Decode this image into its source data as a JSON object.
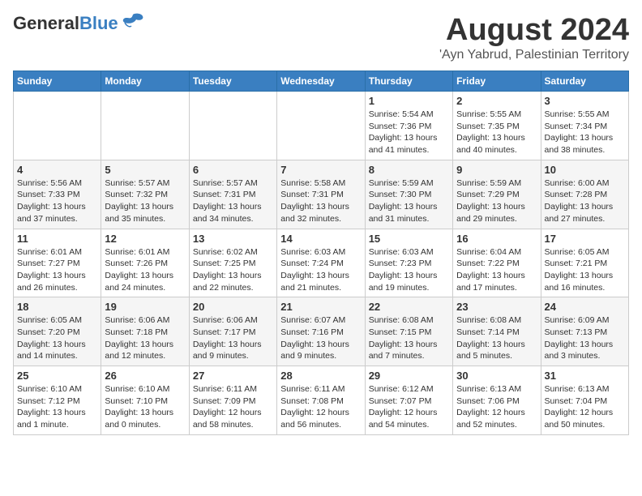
{
  "header": {
    "logo_general": "General",
    "logo_blue": "Blue",
    "month_year": "August 2024",
    "location": "'Ayn Yabrud, Palestinian Territory"
  },
  "weekdays": [
    "Sunday",
    "Monday",
    "Tuesday",
    "Wednesday",
    "Thursday",
    "Friday",
    "Saturday"
  ],
  "weeks": [
    [
      {
        "day": "",
        "info": ""
      },
      {
        "day": "",
        "info": ""
      },
      {
        "day": "",
        "info": ""
      },
      {
        "day": "",
        "info": ""
      },
      {
        "day": "1",
        "info": "Sunrise: 5:54 AM\nSunset: 7:36 PM\nDaylight: 13 hours and 41 minutes."
      },
      {
        "day": "2",
        "info": "Sunrise: 5:55 AM\nSunset: 7:35 PM\nDaylight: 13 hours and 40 minutes."
      },
      {
        "day": "3",
        "info": "Sunrise: 5:55 AM\nSunset: 7:34 PM\nDaylight: 13 hours and 38 minutes."
      }
    ],
    [
      {
        "day": "4",
        "info": "Sunrise: 5:56 AM\nSunset: 7:33 PM\nDaylight: 13 hours and 37 minutes."
      },
      {
        "day": "5",
        "info": "Sunrise: 5:57 AM\nSunset: 7:32 PM\nDaylight: 13 hours and 35 minutes."
      },
      {
        "day": "6",
        "info": "Sunrise: 5:57 AM\nSunset: 7:31 PM\nDaylight: 13 hours and 34 minutes."
      },
      {
        "day": "7",
        "info": "Sunrise: 5:58 AM\nSunset: 7:31 PM\nDaylight: 13 hours and 32 minutes."
      },
      {
        "day": "8",
        "info": "Sunrise: 5:59 AM\nSunset: 7:30 PM\nDaylight: 13 hours and 31 minutes."
      },
      {
        "day": "9",
        "info": "Sunrise: 5:59 AM\nSunset: 7:29 PM\nDaylight: 13 hours and 29 minutes."
      },
      {
        "day": "10",
        "info": "Sunrise: 6:00 AM\nSunset: 7:28 PM\nDaylight: 13 hours and 27 minutes."
      }
    ],
    [
      {
        "day": "11",
        "info": "Sunrise: 6:01 AM\nSunset: 7:27 PM\nDaylight: 13 hours and 26 minutes."
      },
      {
        "day": "12",
        "info": "Sunrise: 6:01 AM\nSunset: 7:26 PM\nDaylight: 13 hours and 24 minutes."
      },
      {
        "day": "13",
        "info": "Sunrise: 6:02 AM\nSunset: 7:25 PM\nDaylight: 13 hours and 22 minutes."
      },
      {
        "day": "14",
        "info": "Sunrise: 6:03 AM\nSunset: 7:24 PM\nDaylight: 13 hours and 21 minutes."
      },
      {
        "day": "15",
        "info": "Sunrise: 6:03 AM\nSunset: 7:23 PM\nDaylight: 13 hours and 19 minutes."
      },
      {
        "day": "16",
        "info": "Sunrise: 6:04 AM\nSunset: 7:22 PM\nDaylight: 13 hours and 17 minutes."
      },
      {
        "day": "17",
        "info": "Sunrise: 6:05 AM\nSunset: 7:21 PM\nDaylight: 13 hours and 16 minutes."
      }
    ],
    [
      {
        "day": "18",
        "info": "Sunrise: 6:05 AM\nSunset: 7:20 PM\nDaylight: 13 hours and 14 minutes."
      },
      {
        "day": "19",
        "info": "Sunrise: 6:06 AM\nSunset: 7:18 PM\nDaylight: 13 hours and 12 minutes."
      },
      {
        "day": "20",
        "info": "Sunrise: 6:06 AM\nSunset: 7:17 PM\nDaylight: 13 hours and 9 minutes."
      },
      {
        "day": "21",
        "info": "Sunrise: 6:07 AM\nSunset: 7:16 PM\nDaylight: 13 hours and 9 minutes."
      },
      {
        "day": "22",
        "info": "Sunrise: 6:08 AM\nSunset: 7:15 PM\nDaylight: 13 hours and 7 minutes."
      },
      {
        "day": "23",
        "info": "Sunrise: 6:08 AM\nSunset: 7:14 PM\nDaylight: 13 hours and 5 minutes."
      },
      {
        "day": "24",
        "info": "Sunrise: 6:09 AM\nSunset: 7:13 PM\nDaylight: 13 hours and 3 minutes."
      }
    ],
    [
      {
        "day": "25",
        "info": "Sunrise: 6:10 AM\nSunset: 7:12 PM\nDaylight: 13 hours and 1 minute."
      },
      {
        "day": "26",
        "info": "Sunrise: 6:10 AM\nSunset: 7:10 PM\nDaylight: 13 hours and 0 minutes."
      },
      {
        "day": "27",
        "info": "Sunrise: 6:11 AM\nSunset: 7:09 PM\nDaylight: 12 hours and 58 minutes."
      },
      {
        "day": "28",
        "info": "Sunrise: 6:11 AM\nSunset: 7:08 PM\nDaylight: 12 hours and 56 minutes."
      },
      {
        "day": "29",
        "info": "Sunrise: 6:12 AM\nSunset: 7:07 PM\nDaylight: 12 hours and 54 minutes."
      },
      {
        "day": "30",
        "info": "Sunrise: 6:13 AM\nSunset: 7:06 PM\nDaylight: 12 hours and 52 minutes."
      },
      {
        "day": "31",
        "info": "Sunrise: 6:13 AM\nSunset: 7:04 PM\nDaylight: 12 hours and 50 minutes."
      }
    ]
  ]
}
